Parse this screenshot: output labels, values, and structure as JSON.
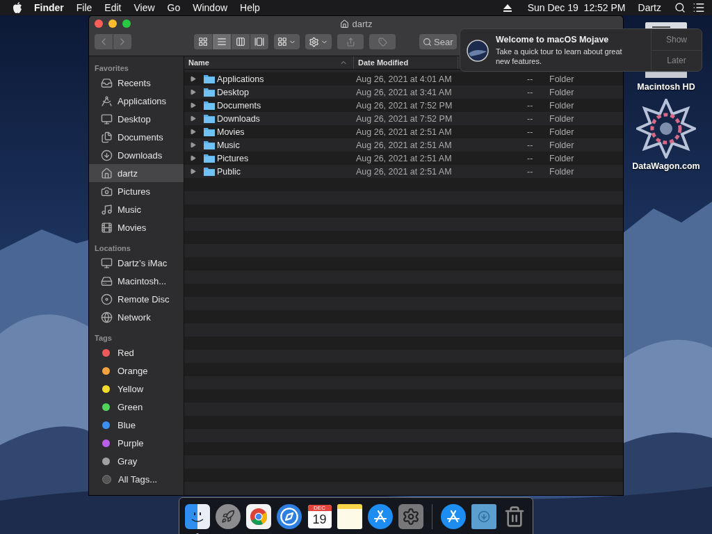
{
  "menu_bar": {
    "app": "Finder",
    "menus": [
      "File",
      "Edit",
      "View",
      "Go",
      "Window",
      "Help"
    ],
    "clock": "Sun Dec 19  12:52 PM",
    "user": "Dartz"
  },
  "window": {
    "title": "dartz",
    "view_modes": [
      {
        "kind": "icons",
        "selected": false
      },
      {
        "kind": "list",
        "selected": true
      },
      {
        "kind": "columns",
        "selected": false
      },
      {
        "kind": "gallery",
        "selected": false
      }
    ],
    "search": {
      "placeholder": "Sear"
    }
  },
  "sidebar": [
    {
      "heading": "Favorites",
      "items": [
        {
          "label": "Recents",
          "selected": false
        },
        {
          "label": "Applications",
          "selected": false
        },
        {
          "label": "Desktop",
          "selected": false
        },
        {
          "label": "Documents",
          "selected": false
        },
        {
          "label": "Downloads",
          "selected": false
        },
        {
          "label": "dartz",
          "selected": true
        },
        {
          "label": "Pictures",
          "selected": false
        },
        {
          "label": "Music",
          "selected": false
        },
        {
          "label": "Movies",
          "selected": false
        }
      ]
    },
    {
      "heading": "Locations",
      "items": [
        {
          "label": "Dartz’s iMac",
          "selected": false
        },
        {
          "label": "Macintosh...",
          "selected": false
        },
        {
          "label": "Remote Disc",
          "selected": false
        },
        {
          "label": "Network",
          "selected": false
        }
      ]
    },
    {
      "heading": "Tags",
      "items": [
        {
          "label": "Red",
          "selected": false,
          "color": "#ee5a5a"
        },
        {
          "label": "Orange",
          "selected": false,
          "color": "#f5a33c"
        },
        {
          "label": "Yellow",
          "selected": false,
          "color": "#f4dc2c"
        },
        {
          "label": "Green",
          "selected": false,
          "color": "#4fd65a"
        },
        {
          "label": "Blue",
          "selected": false,
          "color": "#3b8ff6"
        },
        {
          "label": "Purple",
          "selected": false,
          "color": "#b95ee8"
        },
        {
          "label": "Gray",
          "selected": false,
          "color": "#a0a0a0"
        },
        {
          "label": "All Tags...",
          "selected": false
        }
      ]
    }
  ],
  "table": {
    "columns": [
      {
        "label": "Name",
        "sorted": true
      },
      {
        "label": "Date Modified",
        "sorted": false
      }
    ],
    "rows": [
      {
        "name": "Applications",
        "date_modified": "Aug 26, 2021 at 4:01 AM",
        "column_3": "--",
        "column_4": "Folder",
        "expanded": false
      },
      {
        "name": "Desktop",
        "date_modified": "Aug 26, 2021 at 3:41 AM",
        "column_3": "--",
        "column_4": "Folder",
        "expanded": false
      },
      {
        "name": "Documents",
        "date_modified": "Aug 26, 2021 at 7:52 PM",
        "column_3": "--",
        "column_4": "Folder",
        "expanded": false
      },
      {
        "name": "Downloads",
        "date_modified": "Aug 26, 2021 at 7:52 PM",
        "column_3": "--",
        "column_4": "Folder",
        "expanded": false
      },
      {
        "name": "Movies",
        "date_modified": "Aug 26, 2021 at 2:51 AM",
        "column_3": "--",
        "column_4": "Folder",
        "expanded": false
      },
      {
        "name": "Music",
        "date_modified": "Aug 26, 2021 at 2:51 AM",
        "column_3": "--",
        "column_4": "Folder",
        "expanded": false
      },
      {
        "name": "Pictures",
        "date_modified": "Aug 26, 2021 at 2:51 AM",
        "column_3": "--",
        "column_4": "Folder",
        "expanded": false
      },
      {
        "name": "Public",
        "date_modified": "Aug 26, 2021 at 2:51 AM",
        "column_3": "--",
        "column_4": "Folder",
        "expanded": false
      }
    ]
  },
  "notification": {
    "title": "Welcome to macOS Mojave",
    "body": "Take a quick tour to learn about great new features.",
    "actions": [
      "Show",
      "Later"
    ]
  },
  "desktop_icons": [
    {
      "label": "Macintosh HD"
    },
    {
      "label": "DataWagon.com"
    }
  ],
  "dock": [
    {
      "kind": "finder",
      "running": true
    },
    {
      "kind": "launchpad",
      "running": false
    },
    {
      "kind": "chrome",
      "running": false
    },
    {
      "kind": "safari",
      "running": false
    },
    {
      "kind": "calendar",
      "running": false,
      "month": "DEC",
      "day": "19"
    },
    {
      "kind": "notes",
      "running": false
    },
    {
      "kind": "appstore",
      "running": false
    },
    {
      "kind": "settings",
      "running": false
    },
    {
      "kind": "separator"
    },
    {
      "kind": "appstore",
      "running": false
    },
    {
      "kind": "downloads",
      "running": false
    },
    {
      "kind": "trash",
      "running": false
    }
  ]
}
